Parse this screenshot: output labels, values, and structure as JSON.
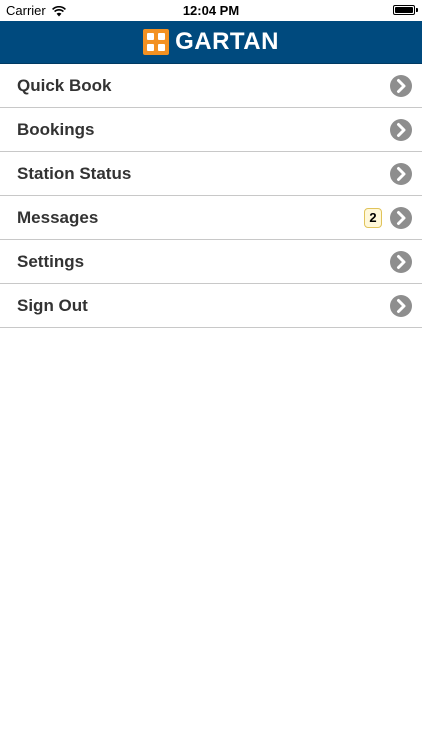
{
  "status_bar": {
    "carrier": "Carrier",
    "time": "12:04 PM",
    "wifi_icon": "wifi-icon",
    "battery_icon": "battery-icon"
  },
  "header": {
    "logo_text": "GARTAN",
    "logo_icon": "gartan-logo-icon",
    "background_color": "#004a7e",
    "logo_accent_color": "#f39122"
  },
  "menu": {
    "items": [
      {
        "label": "Quick Book",
        "icon": "chevron-right-icon"
      },
      {
        "label": "Bookings",
        "icon": "chevron-right-icon"
      },
      {
        "label": "Station Status",
        "icon": "chevron-right-icon"
      },
      {
        "label": "Messages",
        "badge": "2",
        "icon": "chevron-right-icon"
      },
      {
        "label": "Settings",
        "icon": "chevron-right-icon"
      },
      {
        "label": "Sign Out",
        "icon": "chevron-right-icon"
      }
    ]
  }
}
